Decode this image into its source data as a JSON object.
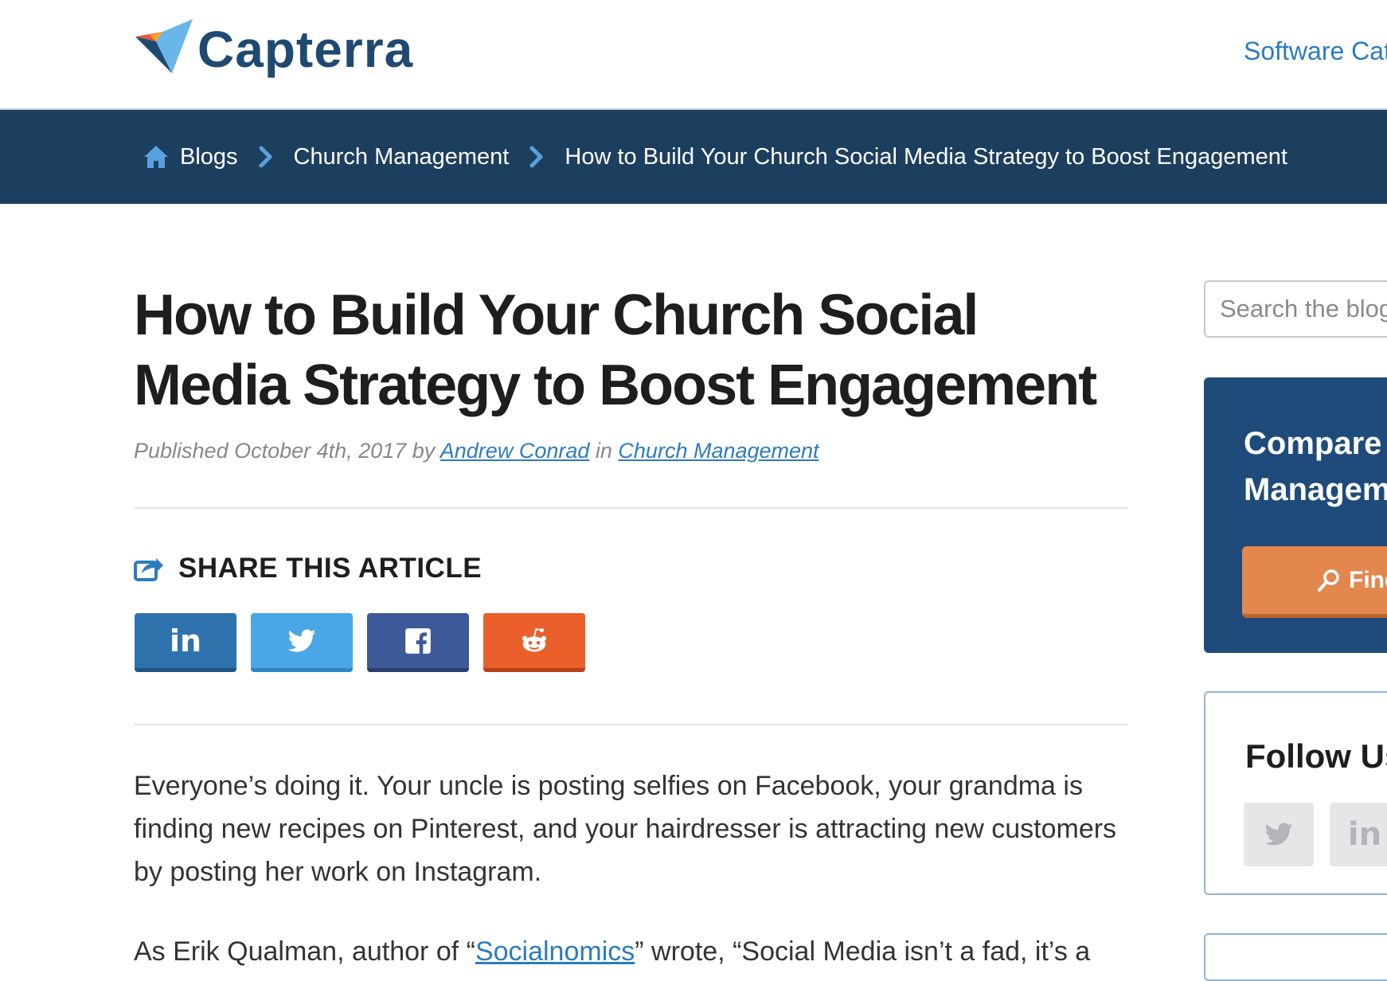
{
  "brand": {
    "name": "Capterra"
  },
  "top_nav": {
    "software_categories": "Software Cat"
  },
  "breadcrumb": {
    "items": [
      {
        "label": "Blogs"
      },
      {
        "label": "Church Management"
      },
      {
        "label": "How to Build Your Church Social Media Strategy to Boost Engagement"
      }
    ]
  },
  "article": {
    "title": "How to Build Your Church Social Media Strategy to Boost Engagement",
    "meta": {
      "published": "Published October 4th, 2017 by",
      "author": "Andrew Conrad",
      "in_word": "in",
      "category": "Church Management"
    },
    "share": {
      "heading": "SHARE THIS ARTICLE",
      "buttons": [
        {
          "network": "linkedin",
          "icon": "linkedin-icon",
          "color": "#2f73ae"
        },
        {
          "network": "twitter",
          "icon": "twitter-icon",
          "color": "#4aa6e4"
        },
        {
          "network": "facebook",
          "icon": "facebook-icon",
          "color": "#3d5997"
        },
        {
          "network": "reddit",
          "icon": "reddit-icon",
          "color": "#ea5f2a"
        }
      ]
    },
    "paragraphs": {
      "p1": "Everyone’s doing it. Your uncle is posting selfies on Facebook, your grandma is finding new recipes on Pinterest, and your hairdresser is attracting new customers by posting her work on Instagram.",
      "p2_before": "As Erik Qualman, author of “",
      "p2_link": "Socialnomics",
      "p2_after": "” wrote, “Social Media isn’t a fad, it’s a"
    }
  },
  "sidebar": {
    "search": {
      "placeholder": "Search the blog"
    },
    "compare": {
      "line1": "Compare",
      "line2": "Managem",
      "button": "Find"
    },
    "follow": {
      "title": "Follow Us"
    }
  },
  "colors": {
    "brand_navy": "#1d3f5f",
    "link_blue": "#2d7bbf",
    "cta_orange": "#e2874e"
  }
}
